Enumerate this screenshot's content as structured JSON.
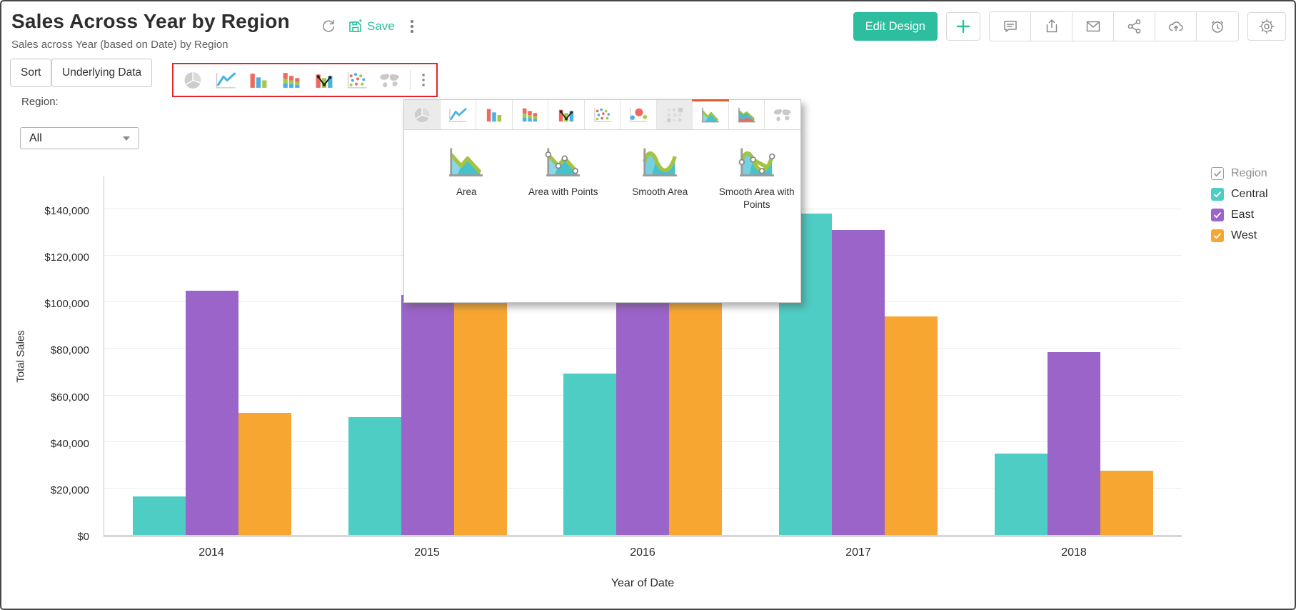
{
  "header": {
    "title": "Sales Across Year by Region",
    "subtitle": "Sales across Year (based on Date) by Region",
    "save_label": "Save",
    "edit_design_label": "Edit Design"
  },
  "toolbar": {
    "sort_label": "Sort",
    "underlying_data_label": "Underlying Data",
    "chart_types": [
      "pie",
      "line",
      "bar",
      "stacked-bar",
      "combo",
      "scatter",
      "map"
    ]
  },
  "filter": {
    "label": "Region:",
    "value": "All"
  },
  "chart_picker": {
    "tabs": [
      {
        "id": "pie",
        "selected": false
      },
      {
        "id": "line",
        "selected": false
      },
      {
        "id": "bar",
        "selected": false
      },
      {
        "id": "stacked-bar",
        "selected": false
      },
      {
        "id": "combo",
        "selected": false
      },
      {
        "id": "scatter",
        "selected": false
      },
      {
        "id": "bubble",
        "selected": false
      },
      {
        "id": "heatmap",
        "selected": false
      },
      {
        "id": "area",
        "selected": true
      },
      {
        "id": "stacked-area",
        "selected": false
      },
      {
        "id": "map",
        "selected": false
      }
    ],
    "options": [
      {
        "id": "area",
        "label": "Area"
      },
      {
        "id": "area-points",
        "label": "Area with Points"
      },
      {
        "id": "smooth-area",
        "label": "Smooth Area"
      },
      {
        "id": "smooth-area-points",
        "label": "Smooth Area with Points"
      }
    ]
  },
  "legend": {
    "title": "Region",
    "items": [
      {
        "label": "Central",
        "color": "#4ecdc4",
        "checked": true
      },
      {
        "label": "East",
        "color": "#9b64c8",
        "checked": true
      },
      {
        "label": "West",
        "color": "#f7a731",
        "checked": true
      }
    ]
  },
  "colors": {
    "accent_teal": "#2cbe9e",
    "highlight_red_outline": "#e8252b",
    "selected_tab_orange": "#e2592c"
  },
  "chart_data": {
    "type": "bar",
    "title": "Sales Across Year by Region",
    "xlabel": "Year of Date",
    "ylabel": "Total Sales",
    "categories": [
      "2014",
      "2015",
      "2016",
      "2017",
      "2018"
    ],
    "series": [
      {
        "name": "Central",
        "color": "#4ecdc4",
        "values": [
          16500,
          50500,
          69500,
          138000,
          35000
        ]
      },
      {
        "name": "East",
        "color": "#9b64c8",
        "values": [
          105000,
          103000,
          103000,
          131000,
          78500
        ]
      },
      {
        "name": "West",
        "color": "#f7a731",
        "values": [
          52500,
          103000,
          103000,
          94000,
          27500
        ]
      }
    ],
    "y_ticks": [
      {
        "value": 0,
        "label": "$0"
      },
      {
        "value": 20000,
        "label": "$20,000"
      },
      {
        "value": 40000,
        "label": "$40,000"
      },
      {
        "value": 60000,
        "label": "$60,000"
      },
      {
        "value": 80000,
        "label": "$80,000"
      },
      {
        "value": 100000,
        "label": "$100,000"
      },
      {
        "value": 120000,
        "label": "$120,000"
      },
      {
        "value": 140000,
        "label": "$140,000"
      }
    ],
    "ylim": [
      0,
      155000
    ],
    "grid": true,
    "legend_position": "right"
  }
}
